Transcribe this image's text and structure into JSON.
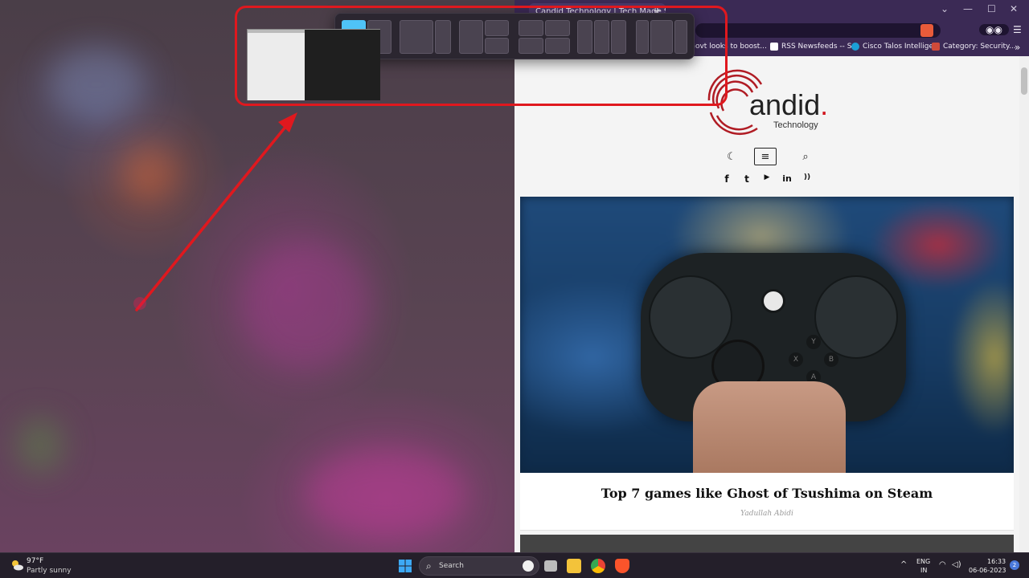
{
  "browser": {
    "tab_title": "Candid Technology | Tech Made S",
    "tab_close": "×",
    "new_tab": "+",
    "window_controls": {
      "minimize": "—",
      "maximize": "☐",
      "close": "✕"
    },
    "bookmarks": [
      {
        "label": "Govt looks to boost...",
        "color": "#2b2b2b"
      },
      {
        "label": "RSS Newsfeeds -- S...",
        "color": "#ffffff"
      },
      {
        "label": "Cisco Talos Intellige...",
        "color": "#1ba0d7"
      },
      {
        "label": "Category: Security...",
        "color": "#d04a3a"
      }
    ],
    "bookmarks_more": "»",
    "menu": "☰"
  },
  "site": {
    "logo_text": "andid",
    "logo_dot": ".",
    "logo_sub": "Technology",
    "nav": {
      "darkmode": "☾",
      "menu": "≡",
      "search": "⌕"
    },
    "social": [
      "f",
      "t",
      "▶",
      "in",
      "))"
    ],
    "article": {
      "title": "Top 7 games like Ghost of Tsushima on Steam",
      "author": "Yadullah Abidi"
    }
  },
  "controller": {
    "buttons": [
      "Y",
      "B",
      "X",
      "A"
    ]
  },
  "taskbar": {
    "weather_temp": "97°F",
    "weather_desc": "Partly sunny",
    "search_label": "Search",
    "search_icon": "⌕",
    "language_top": "ENG",
    "language_bottom": "IN",
    "time": "16:33",
    "date": "06-06-2023",
    "notification_count": "2",
    "tray_chevron": "^",
    "wifi_glyph": "◠",
    "volume_glyph": "◁)"
  },
  "colors": {
    "accent": "#4fc3f7",
    "annotation": "#e0181e",
    "taskbar": "#241f2a"
  }
}
